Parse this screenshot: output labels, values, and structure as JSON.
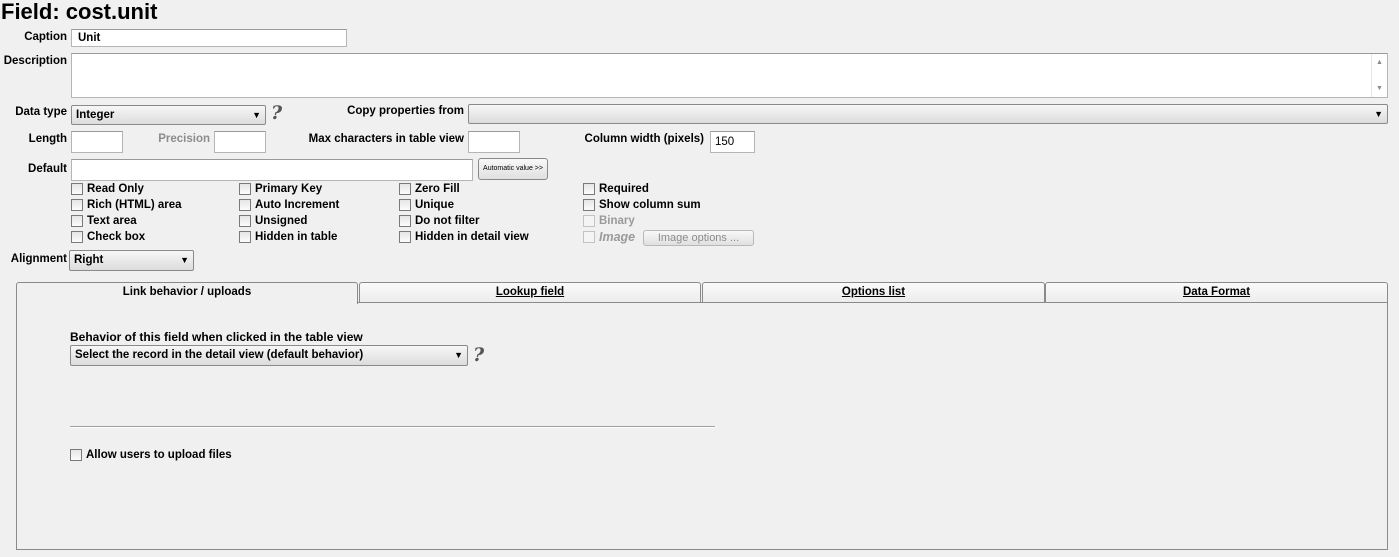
{
  "title": "Field: cost.unit",
  "caption": {
    "label": "Caption",
    "value": "Unit"
  },
  "description": {
    "label": "Description",
    "value": ""
  },
  "data_type": {
    "label": "Data type",
    "value": "Integer",
    "help": "?"
  },
  "copy_properties": {
    "label": "Copy properties from",
    "value": ""
  },
  "length": {
    "label": "Length",
    "value": ""
  },
  "precision": {
    "label": "Precision",
    "value": ""
  },
  "max_chars": {
    "label": "Max characters in table view",
    "value": ""
  },
  "column_width": {
    "label": "Column width (pixels)",
    "value": "150"
  },
  "default": {
    "label": "Default",
    "value": "",
    "auto_button": "Automatic value >>"
  },
  "checkboxes": {
    "read_only": "Read Only",
    "rich_html": "Rich (HTML) area",
    "text_area": "Text area",
    "check_box": "Check box",
    "primary_key": "Primary Key",
    "auto_increment": "Auto Increment",
    "unsigned": "Unsigned",
    "hidden_table": "Hidden in table",
    "zero_fill": "Zero Fill",
    "unique": "Unique",
    "do_not_filter": "Do not filter",
    "hidden_detail": "Hidden in detail view",
    "required": "Required",
    "show_sum": "Show column sum",
    "binary": "Binary",
    "image": "Image"
  },
  "image_options_button": "Image options ...",
  "alignment": {
    "label": "Alignment",
    "value": "Right"
  },
  "tabs": {
    "link": "Link behavior / uploads",
    "lookup": "Lookup field",
    "options": "Options list",
    "format": "Data Format"
  },
  "link_panel": {
    "behavior_label": "Behavior of this field when clicked in the table view",
    "behavior_value": "Select the record in the detail view (default behavior)",
    "help": "?",
    "allow_upload": "Allow users to upload files"
  }
}
